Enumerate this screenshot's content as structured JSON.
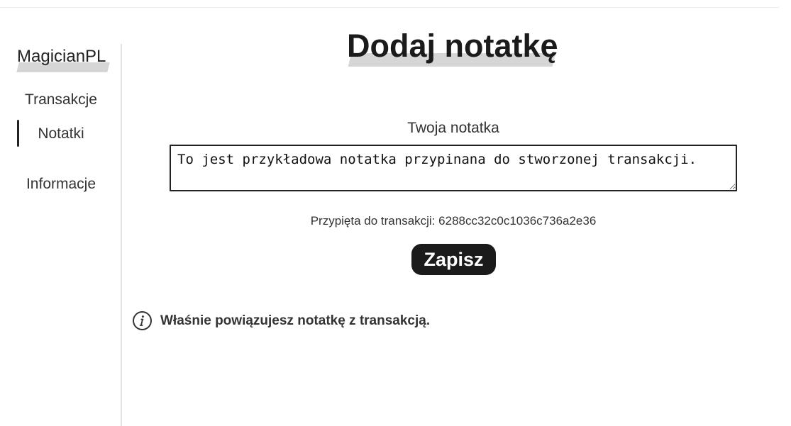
{
  "sidebar": {
    "brand": "MagicianPL",
    "items": [
      {
        "label": "Transakcje"
      },
      {
        "label": "Notatki",
        "active": true
      },
      {
        "label": "Informacje"
      }
    ]
  },
  "main": {
    "title": "Dodaj notatkę",
    "note_label": "Twoja notatka",
    "note_value": "To jest przykładowa notatka przypinana do stworzonej transakcji.",
    "pinned_info": "Przypięta do transakcji: 6288cc32c0c1036c736a2e36",
    "save_label": "Zapisz",
    "notice": {
      "icon": "info-icon",
      "text": "Właśnie powiązujesz notatkę z transakcją."
    }
  }
}
